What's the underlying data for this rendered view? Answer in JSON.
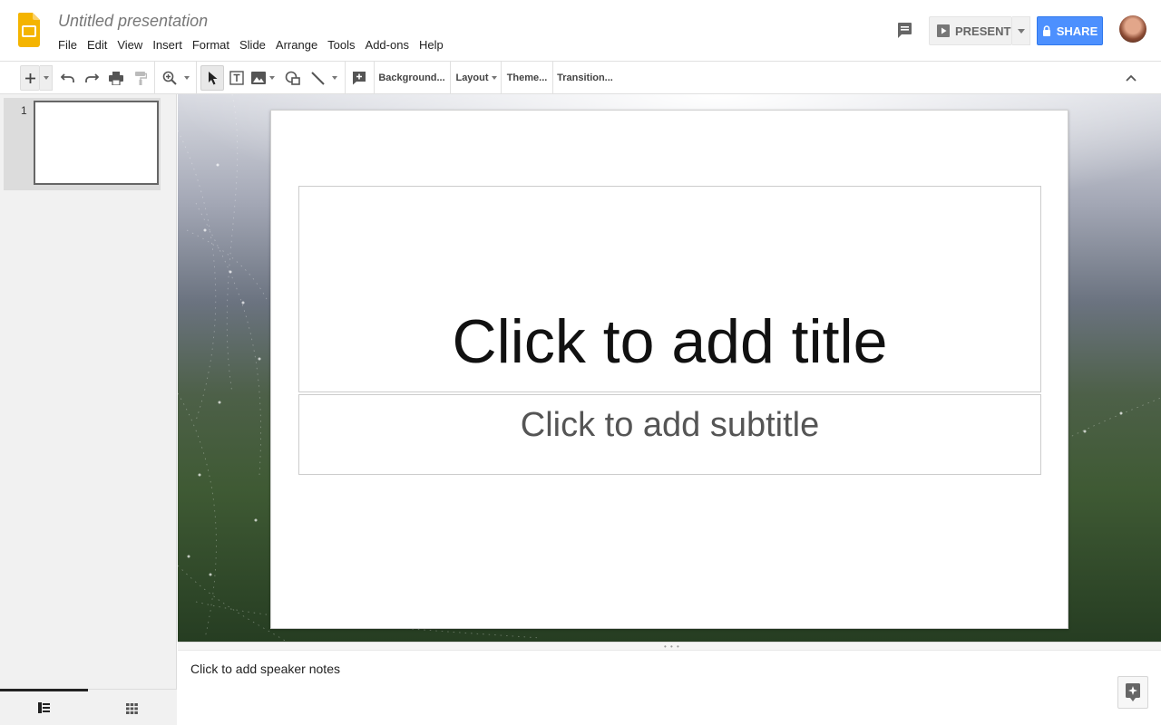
{
  "header": {
    "doc_title": "Untitled presentation",
    "menu": [
      "File",
      "Edit",
      "View",
      "Insert",
      "Format",
      "Slide",
      "Arrange",
      "Tools",
      "Add-ons",
      "Help"
    ],
    "present_label": "PRESENT",
    "share_label": "SHARE",
    "brand_color": "#f4b400",
    "share_color": "#4d90fe"
  },
  "toolbar": {
    "background_label": "Background...",
    "layout_label": "Layout",
    "theme_label": "Theme...",
    "transition_label": "Transition..."
  },
  "filmstrip": {
    "slides": [
      {
        "number": "1"
      }
    ]
  },
  "slide": {
    "title_placeholder": "Click to add title",
    "subtitle_placeholder": "Click to add subtitle"
  },
  "notes": {
    "placeholder": "Click to add speaker notes"
  }
}
